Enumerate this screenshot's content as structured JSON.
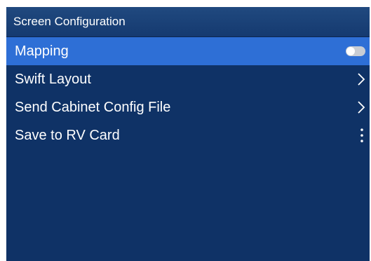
{
  "header": {
    "title": "Screen Configuration"
  },
  "menu": {
    "items": [
      {
        "label": "Mapping",
        "control": "toggle-icon",
        "toggle_on": false,
        "selected": true
      },
      {
        "label": "Swift Layout",
        "control": "chevron-right-icon"
      },
      {
        "label": "Send Cabinet Config File",
        "control": "chevron-right-icon"
      },
      {
        "label": "Save to RV Card",
        "control": "more-vertical-icon"
      }
    ]
  },
  "colors": {
    "background": "#0f3266",
    "header": "#1b437a",
    "selected": "#2e6fd6",
    "text": "#ffffff",
    "toggle_track": "#c9cdd4"
  }
}
